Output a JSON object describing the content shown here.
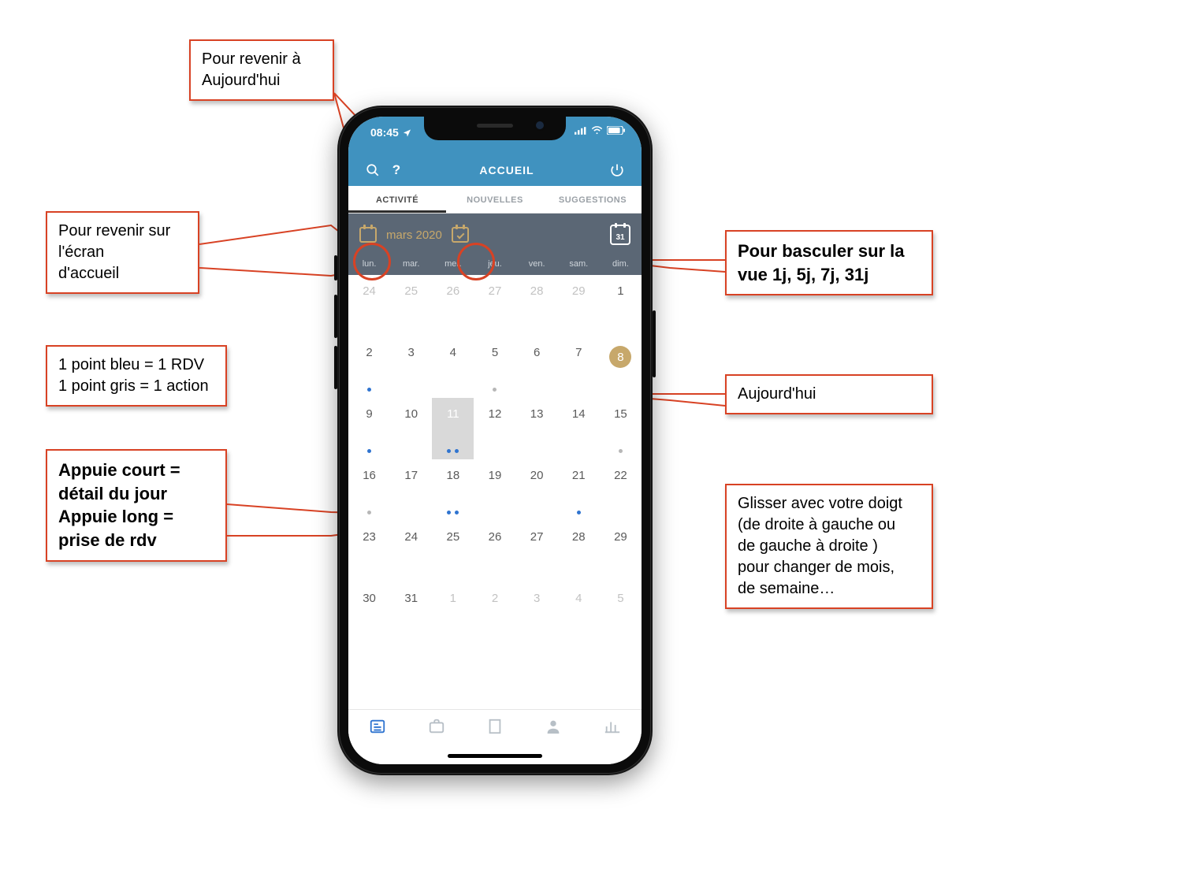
{
  "callouts": {
    "returnToday": "Pour revenir à\nAujourd'hui",
    "returnHome": "Pour revenir sur\nl'écran\nd'accueil",
    "dotsLegend": "1 point bleu = 1 RDV\n1 point gris = 1 action",
    "tapLegend": "Appuie court =\ndétail du jour\nAppuie long =\nprise de rdv",
    "switchView": "Pour basculer sur la\nvue 1j, 5j, 7j, 31j",
    "todayLabel": "Aujourd'hui",
    "swipeHint": "Glisser avec votre doigt\n(de droite à gauche ou\nde gauche à droite )\npour changer de mois,\nde semaine…"
  },
  "statusbar": {
    "time": "08:45"
  },
  "header": {
    "title": "ACCUEIL"
  },
  "tabs": [
    {
      "label": "ACTIVITÉ",
      "active": true
    },
    {
      "label": "NOUVELLES",
      "active": false
    },
    {
      "label": "SUGGESTIONS",
      "active": false
    }
  ],
  "monthbar": {
    "label": "mars 2020",
    "view_badge": "31"
  },
  "dow": [
    "lun.",
    "mar.",
    "mer.",
    "jeu.",
    "ven.",
    "sam.",
    "dim."
  ],
  "calendar": {
    "rows": [
      [
        {
          "n": 24,
          "out": true
        },
        {
          "n": 25,
          "out": true
        },
        {
          "n": 26,
          "out": true
        },
        {
          "n": 27,
          "out": true
        },
        {
          "n": 28,
          "out": true
        },
        {
          "n": 29,
          "out": true
        },
        {
          "n": 1
        }
      ],
      [
        {
          "n": 2,
          "dots": [
            "blue"
          ]
        },
        {
          "n": 3
        },
        {
          "n": 4
        },
        {
          "n": 5,
          "dots": [
            "gray"
          ]
        },
        {
          "n": 6
        },
        {
          "n": 7
        },
        {
          "n": 8,
          "today": true
        }
      ],
      [
        {
          "n": 9,
          "dots": [
            "blue"
          ]
        },
        {
          "n": 10
        },
        {
          "n": 11,
          "selected": true,
          "dots": [
            "blue",
            "blue"
          ]
        },
        {
          "n": 12
        },
        {
          "n": 13
        },
        {
          "n": 14
        },
        {
          "n": 15,
          "dots": [
            "gray"
          ]
        }
      ],
      [
        {
          "n": 16,
          "dots": [
            "gray"
          ]
        },
        {
          "n": 17
        },
        {
          "n": 18,
          "dots": [
            "blue",
            "blue"
          ]
        },
        {
          "n": 19
        },
        {
          "n": 20
        },
        {
          "n": 21,
          "dots": [
            "blue"
          ]
        },
        {
          "n": 22
        }
      ],
      [
        {
          "n": 23
        },
        {
          "n": 24
        },
        {
          "n": 25
        },
        {
          "n": 26
        },
        {
          "n": 27
        },
        {
          "n": 28
        },
        {
          "n": 29
        }
      ],
      [
        {
          "n": 30
        },
        {
          "n": 31
        },
        {
          "n": 1,
          "out": true
        },
        {
          "n": 2,
          "out": true
        },
        {
          "n": 3,
          "out": true
        },
        {
          "n": 4,
          "out": true
        },
        {
          "n": 5,
          "out": true
        }
      ]
    ]
  },
  "bottomnav": [
    "news",
    "briefcase",
    "building",
    "person",
    "stats"
  ]
}
